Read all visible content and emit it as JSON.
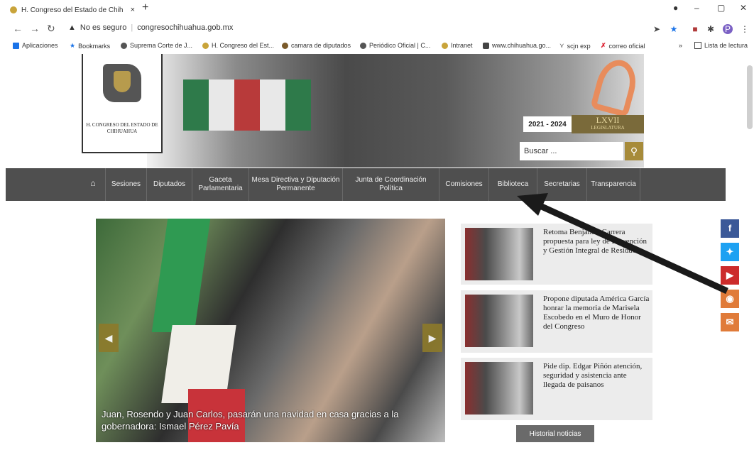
{
  "browser": {
    "tab_title": "H. Congreso del Estado de Chih",
    "tab_close": "×",
    "new_tab": "+",
    "win_min": "–",
    "win_max": "▢",
    "win_close": "✕",
    "security_label": "No es seguro",
    "url": "congresochihuahua.gob.mx",
    "bookmarks": [
      "Aplicaciones",
      "Bookmarks",
      "Suprema Corte de J...",
      "H. Congreso del Est...",
      "camara de diputados",
      "Periódico Oficial | C...",
      "Intranet",
      "www.chihuahua.go...",
      "scjn exp",
      "correo oficial"
    ],
    "overflow": "»",
    "reading_list": "Lista de lectura"
  },
  "header": {
    "logo_text": "H. CONGRESO DEL ESTADO DE CHIHUAHUA",
    "years": "2021 - 2024",
    "legislatura": "LXVII",
    "legislatura_sub": "LEGISLATURA",
    "search_placeholder": "Buscar ..."
  },
  "menu": [
    "Sesiones",
    "Diputados",
    "Gaceta Parlamentaria",
    "Mesa Directiva y Diputación Permanente",
    "Junta de Coordinación Política",
    "Comisiones",
    "Biblioteca",
    "Secretarias",
    "Transparencia"
  ],
  "hero": {
    "caption": "Juan, Rosendo y Juan Carlos, pasarán una navidad en casa gracias a la gobernadora: Ismael Pérez Pavía"
  },
  "news": [
    "Retoma Benjamín Carrera propuesta para ley de Prevención y Gestión Integral de Residuos",
    "Propone diputada América García honrar la memoria de Marisela Escobedo en el Muro de Honor del Congreso",
    "Pide dip. Edgar Piñón atención, seguridad y asistencia ante llegada de paisanos"
  ],
  "history_button": "Historial noticias",
  "colors": {
    "menu_bg": "#4f4f4f",
    "gold": "#a78b3a",
    "facebook": "#3b5998",
    "twitter": "#1da1f2",
    "youtube": "#cc2b2b",
    "rss": "#e07b39",
    "mail": "#e07b39"
  }
}
